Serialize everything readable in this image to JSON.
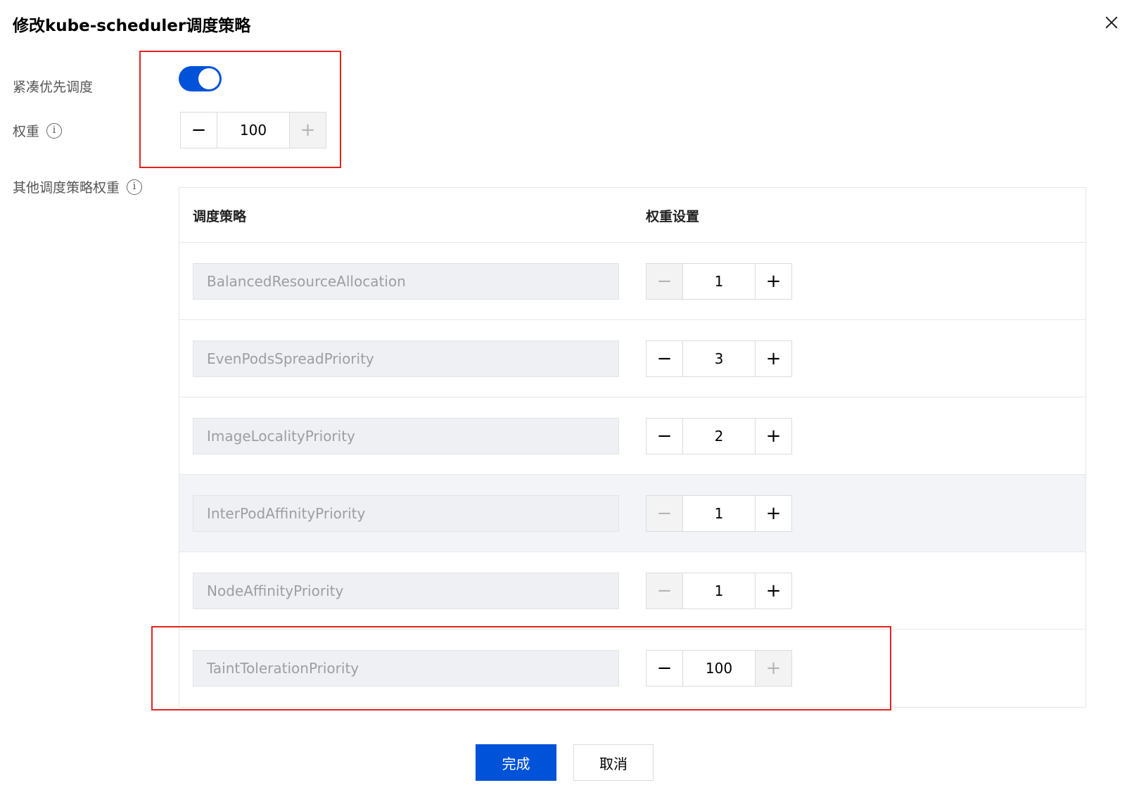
{
  "dialog": {
    "title": "修改kube-scheduler调度策略",
    "close_icon": "close-icon"
  },
  "compact": {
    "label": "紧凑优先调度",
    "toggle_on": true
  },
  "weight": {
    "label": "权重",
    "info_glyph": "i",
    "minus": "−",
    "value": "100",
    "plus": "+"
  },
  "other": {
    "label": "其他调度策略权重",
    "info_glyph": "i"
  },
  "table": {
    "headers": {
      "policy": "调度策略",
      "weight": "权重设置"
    },
    "rows": [
      {
        "name": "BalancedResourceAllocation",
        "minus": "−",
        "value": "1",
        "plus": "+"
      },
      {
        "name": "EvenPodsSpreadPriority",
        "minus": "−",
        "value": "3",
        "plus": "+"
      },
      {
        "name": "ImageLocalityPriority",
        "minus": "−",
        "value": "2",
        "plus": "+"
      },
      {
        "name": "InterPodAffinityPriority",
        "minus": "−",
        "value": "1",
        "plus": "+"
      },
      {
        "name": "NodeAffinityPriority",
        "minus": "−",
        "value": "1",
        "plus": "+"
      },
      {
        "name": "TaintTolerationPriority",
        "minus": "−",
        "value": "100",
        "plus": "+"
      }
    ]
  },
  "footer": {
    "confirm": "完成",
    "cancel": "取消"
  },
  "colors": {
    "primary": "#0052d9",
    "highlight_box": "#e3231e"
  }
}
